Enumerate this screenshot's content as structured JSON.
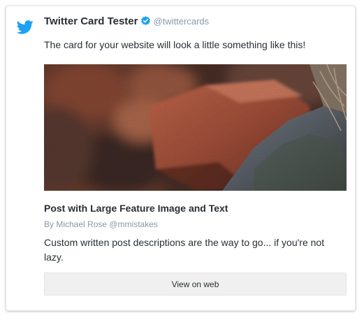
{
  "tweet": {
    "display_name": "Twitter Card Tester",
    "handle": "@twittercards",
    "text": "The card for your website will look a little something like this!"
  },
  "card": {
    "image_alt": "",
    "title": "Post with Large Feature Image and Text",
    "byline": "By Michael Rose @mmistakes",
    "description": "Custom written post descriptions are the way to go... if you're not lazy.",
    "button_label": "View on web"
  },
  "icons": {
    "bird": "twitter-bird-icon",
    "verified": "verified-badge-icon"
  },
  "colors": {
    "brand_blue": "#1da1f2",
    "muted_text": "#8899a6",
    "body_text": "#292f33"
  }
}
